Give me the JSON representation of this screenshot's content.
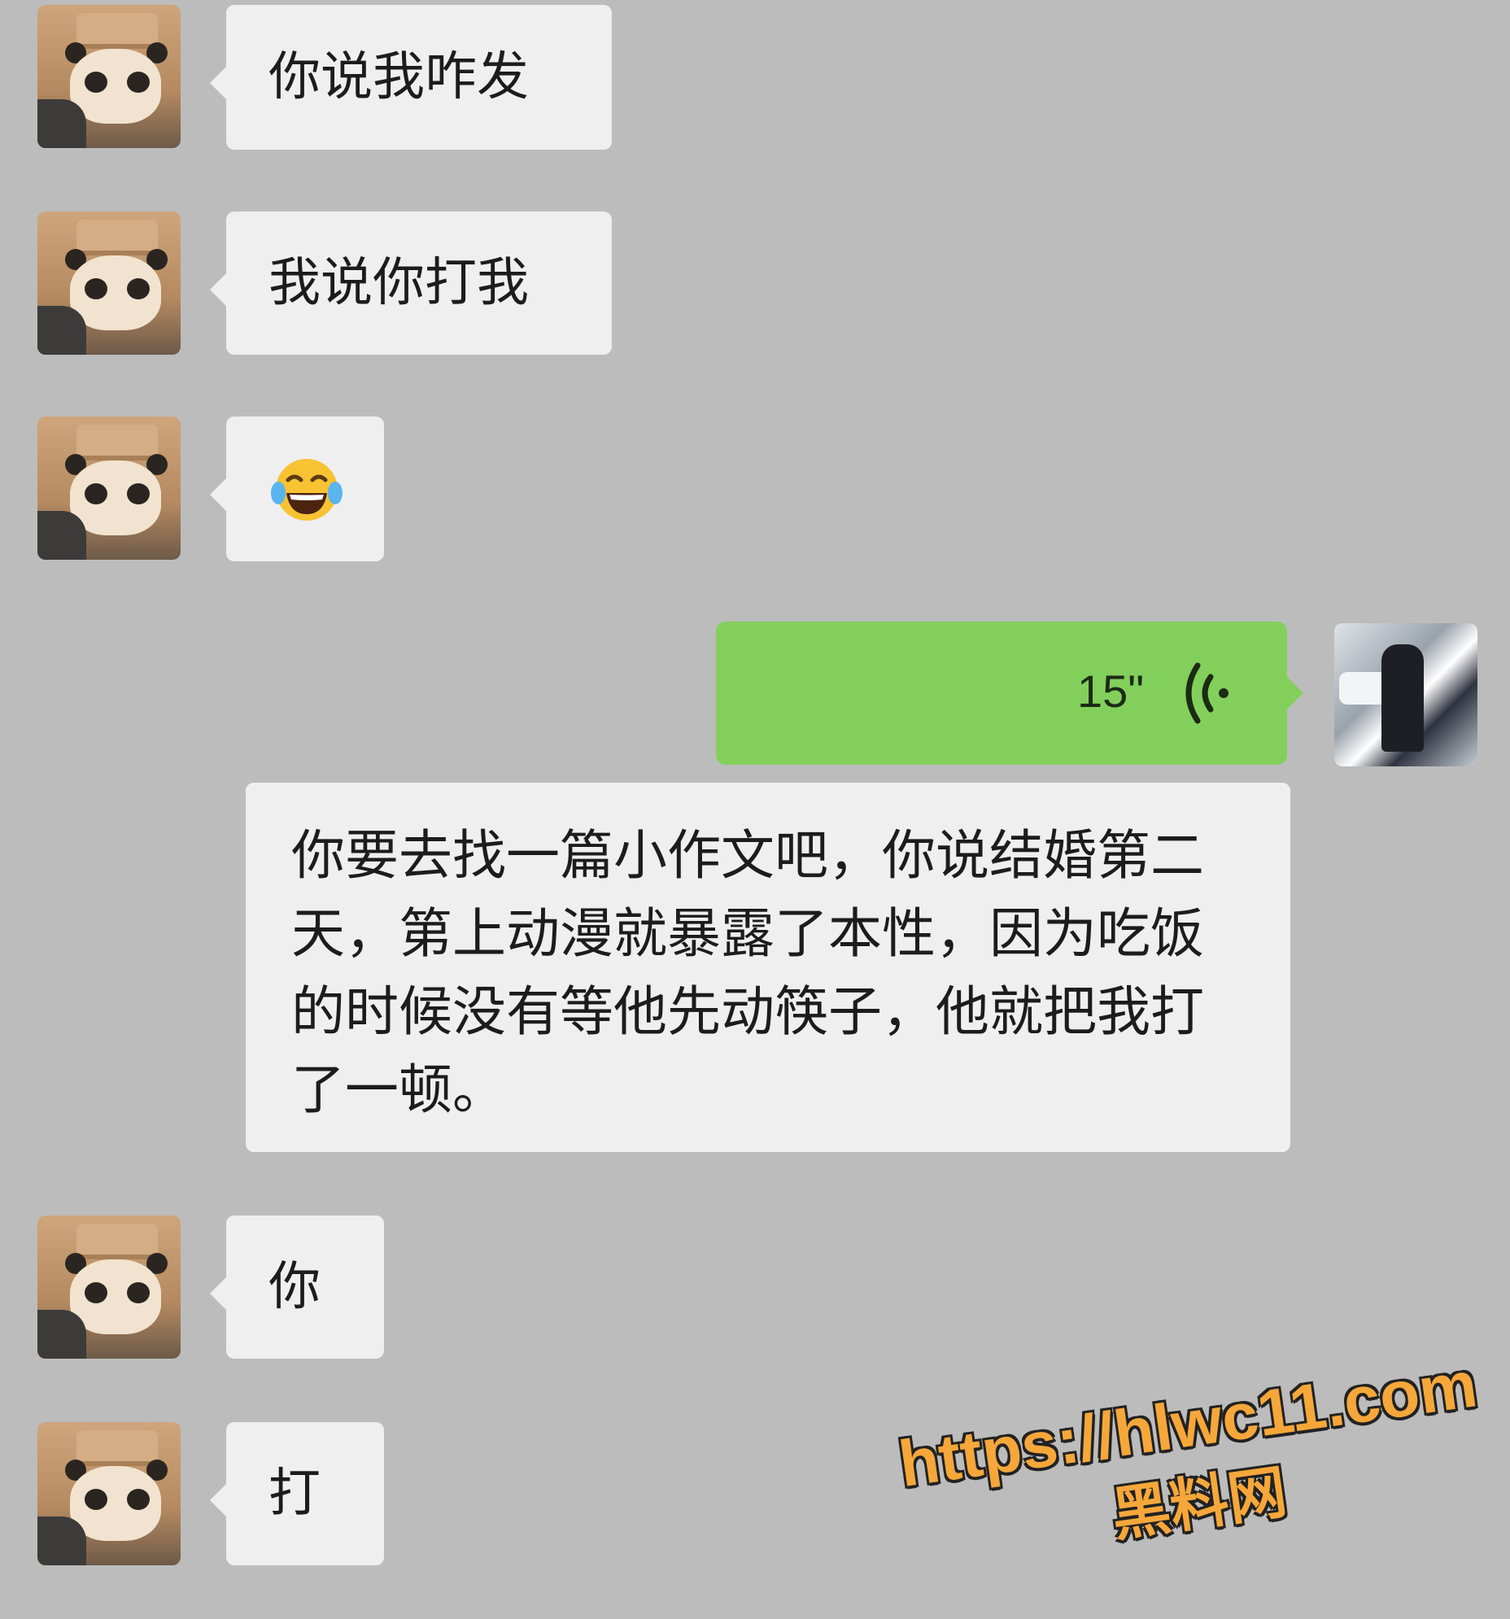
{
  "messages": [
    {
      "side": "left",
      "text": "你说我咋发"
    },
    {
      "side": "left",
      "text": "我说你打我"
    },
    {
      "side": "left",
      "icon": "laughing-tears-emoji-icon"
    },
    {
      "side": "right",
      "type": "voice",
      "duration": "15\""
    },
    {
      "side": "right",
      "type": "transcript",
      "text": "你要去找一篇小作文吧，你说结婚第二天，第上动漫就暴露了本性，因为吃饭的时候没有等他先动筷子，他就把我打了一顿。"
    },
    {
      "side": "left",
      "text": "你"
    },
    {
      "side": "left",
      "text": "打"
    }
  ],
  "avatars": {
    "other": "panda-avatar",
    "self": "user-avatar"
  },
  "watermark": {
    "url": "https://hlwc11.com",
    "name": "黑料网"
  },
  "colors": {
    "background": "#bcbcbc",
    "bubble": "#efefef",
    "voice": "#83cf5c",
    "watermark": "#f6a73a"
  }
}
